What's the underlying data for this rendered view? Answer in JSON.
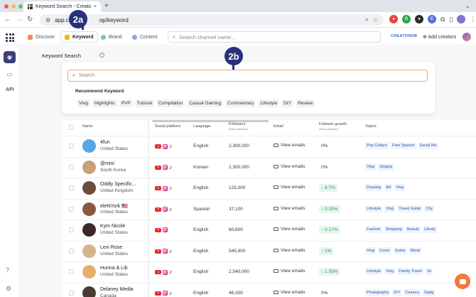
{
  "browser": {
    "tab_title": "Keyword Search - CreatorDB",
    "tab_close": "×",
    "new_tab": "+",
    "url": "app.creatordb.app/keyword",
    "url_visible_left": "app.cre",
    "url_visible_right": "op/keyword",
    "more": "⋮"
  },
  "header": {
    "nav_tabs": [
      {
        "label": "Discover",
        "color": "#f28a52"
      },
      {
        "label": "Keyword",
        "color": "#f4b400"
      },
      {
        "label": "Brand",
        "color": "#7cc6b6"
      },
      {
        "label": "Content",
        "color": "#8aa4e8"
      }
    ],
    "search_placeholder": "Search channel name...",
    "brand_tag": "CREATORDB",
    "add_creators": "Add creators"
  },
  "sidebar": {
    "api_label": "API"
  },
  "callouts": {
    "first": "2a",
    "second": "2b"
  },
  "page": {
    "title": "Keyword Search",
    "search_placeholder": "Search",
    "recommend_label": "Recommend Keyword",
    "recommended_keywords": [
      "Vlog",
      "Highlights",
      "PVP",
      "Tutorial",
      "Compilation",
      "Casual Gaming",
      "Commentary",
      "Lifestyle",
      "DIY",
      "Review"
    ]
  },
  "table": {
    "headers": {
      "name": "Name",
      "platform": "Social platform",
      "language": "Language",
      "followers": "Followers",
      "followers_sub": "(Main platform)",
      "email": "Email",
      "growth": "Follower growth",
      "growth_sub": "(Main platform)",
      "topics": "Topics"
    },
    "rows": [
      {
        "name": "4fun",
        "country": "United States",
        "platforms": [
          "yt",
          "ig",
          "tt"
        ],
        "language": "English",
        "followers": "2,300,000",
        "email": "View emails",
        "growth": "0%",
        "growth_up": false,
        "topics": [
          "Pop Culture",
          "Free Speech",
          "Social Me"
        ],
        "avatar": "#5aa6e0"
      },
      {
        "name": "@mini",
        "country": "South Korea",
        "platforms": [
          "yt",
          "ig",
          "tt"
        ],
        "language": "Korean",
        "followers": "2,300,000",
        "email": "View emails",
        "growth": "0%",
        "growth_up": false,
        "topics": [
          "Vlog",
          "Singing"
        ],
        "avatar": "#c9a07a"
      },
      {
        "name": "Oddly Specific...",
        "country": "United Kingdom",
        "platforms": [
          "yt",
          "ig",
          "tt"
        ],
        "language": "English",
        "followers": "125,000",
        "email": "View emails",
        "growth": "↑ 8.7%",
        "growth_up": true,
        "topics": [
          "Drawing",
          "Art",
          "Vlog"
        ],
        "avatar": "#6b4b3a"
      },
      {
        "name": "eleNYork 🇺🇸",
        "country": "United States",
        "platforms": [
          "yt",
          "ig",
          "tt"
        ],
        "language": "Spanish",
        "followers": "37,100",
        "email": "View emails",
        "growth": "↑ 0.25%",
        "growth_up": true,
        "topics": [
          "Lifestyle",
          "Vlog",
          "Travel Guide",
          "City"
        ],
        "avatar": "#8a5a3c"
      },
      {
        "name": "Kym Nicole",
        "country": "United States",
        "platforms": [
          "yt",
          "ig"
        ],
        "language": "English",
        "followers": "60,600",
        "email": "View emails",
        "growth": "↑ 0.17%",
        "growth_up": true,
        "topics": [
          "Fashion",
          "Shopping",
          "Beauty",
          "Lifesty"
        ],
        "avatar": "#3a2a26"
      },
      {
        "name": "Lexi Rose",
        "country": "United States",
        "platforms": [
          "yt",
          "ig",
          "tt"
        ],
        "language": "English",
        "followers": "545,900",
        "email": "View emails",
        "growth": "↑ 1%",
        "growth_up": true,
        "topics": [
          "Vlog",
          "Cover",
          "Guitar",
          "Metal"
        ],
        "avatar": "#d6b48a"
      },
      {
        "name": "Hunna & Lib",
        "country": "United States",
        "platforms": [
          "yt",
          "ig",
          "tt"
        ],
        "language": "English",
        "followers": "2,540,000",
        "email": "View emails",
        "growth": "↑ 1.55%",
        "growth_up": true,
        "topics": [
          "Lifestyle",
          "Vlog",
          "Family Travel",
          "Ve"
        ],
        "avatar": "#e2b06a"
      },
      {
        "name": "Delaney Media",
        "country": "Canada",
        "platforms": [
          "yt",
          "ig",
          "tt"
        ],
        "language": "English",
        "followers": "46,300",
        "email": "View emails",
        "growth": "0%",
        "growth_up": false,
        "topics": [
          "Photography",
          "DIY",
          "Camera",
          "Gadg"
        ],
        "avatar": "#4a3a34"
      }
    ]
  }
}
